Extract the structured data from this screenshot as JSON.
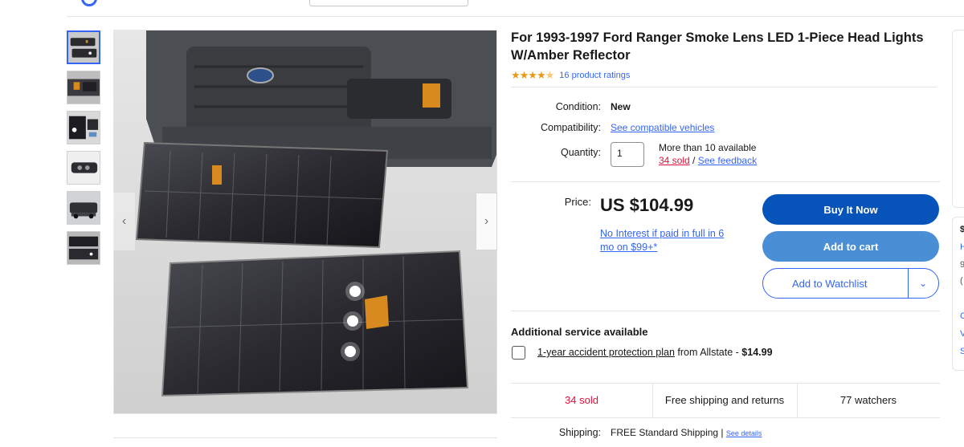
{
  "title": "For 1993-1997 Ford Ranger Smoke Lens LED 1-Piece Head Lights W/Amber Reflector",
  "rating": {
    "stars": 4.5,
    "text": "16 product ratings",
    "color": "#e99a15"
  },
  "condition": {
    "label": "Condition:",
    "value": "New"
  },
  "compatibility": {
    "label": "Compatibility:",
    "link": "See compatible vehicles"
  },
  "quantity": {
    "label": "Quantity:",
    "value": "1",
    "available": "More than 10 available",
    "sold": "34 sold",
    "separator": " / ",
    "feedback": "See feedback"
  },
  "price": {
    "label": "Price:",
    "amount": "US $104.99",
    "financing_line1": "No Interest if paid in full in 6",
    "financing_line2": "mo on $99+*"
  },
  "buttons": {
    "buy_now": "Buy It Now",
    "add_to_cart": "Add to cart",
    "add_to_watchlist": "Add to Watchlist"
  },
  "colors": {
    "accent": "#3665f3",
    "buy": "#0654ba",
    "cart": "#4a8fd6",
    "sold": "#e0103a"
  },
  "service": {
    "heading": "Additional service available",
    "plan_link": "1-year accident protection plan",
    "plan_text": " from Allstate - ",
    "plan_price": "$14.99"
  },
  "stats": {
    "sold": "34 sold",
    "shipping": "Free shipping and returns",
    "watchers": "77 watchers"
  },
  "shipping": {
    "label": "Shipping:",
    "value": "FREE Standard Shipping",
    "separator": " | ",
    "details_link": "See details"
  },
  "thumbnails": [
    "headlight-pair",
    "amber-corner",
    "car-front",
    "single-headlight",
    "car-side",
    "headlight-detail"
  ],
  "side_fragments": [
    "$",
    "H",
    "9",
    "(",
    "C",
    "V",
    "S"
  ]
}
